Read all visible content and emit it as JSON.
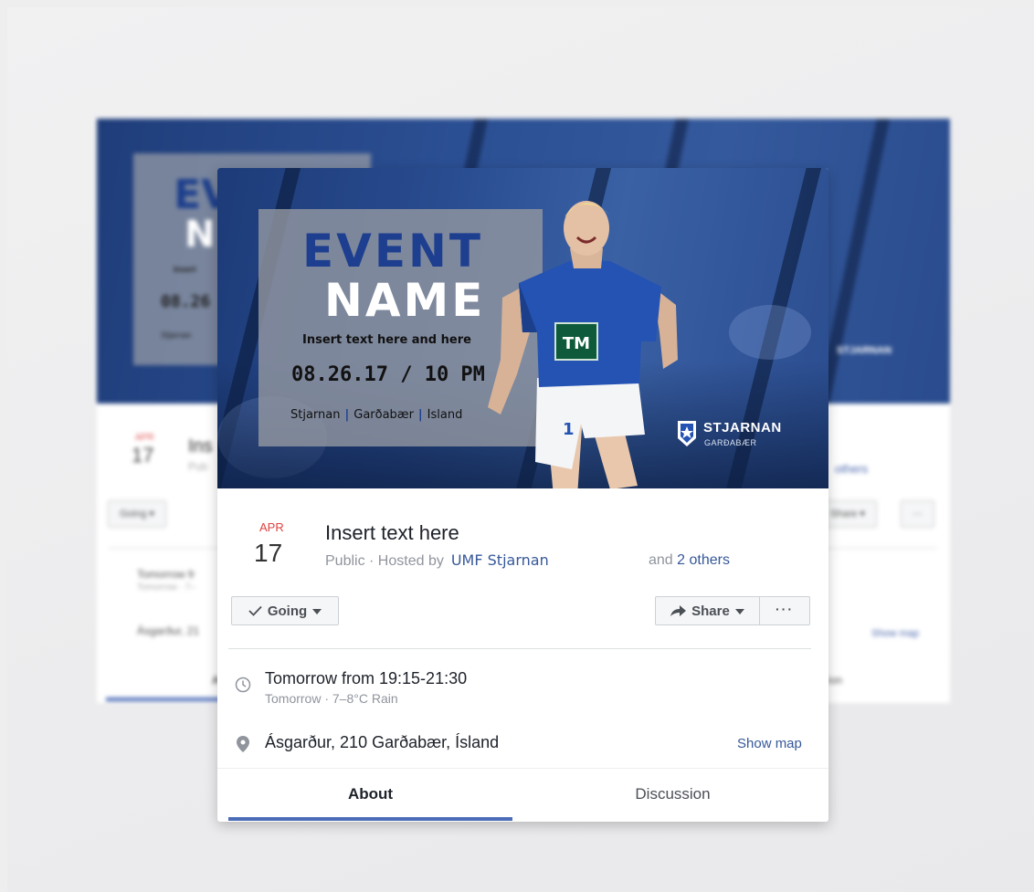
{
  "background_card": {
    "event_fragment": "EV",
    "name_fragment": "N",
    "small_text": "Insert",
    "date_fragment": "08.26",
    "location_fragment": "Stjarnan",
    "month": "APR",
    "day": "17",
    "title_fragment": "Ins",
    "sub_fragment": "Pub",
    "others": "others",
    "going": "Going",
    "share": "Share",
    "time_fragment": "Tomorrow fr",
    "time_sub_fragment": "Tomorrow · 7–",
    "location_row_fragment": "Ásgarður, 21",
    "show_map": "Show map",
    "tab_fragment_left": "A",
    "tab_fragment_right": "ion",
    "logo_text": "STJARNAN"
  },
  "cover": {
    "headline_1": "EVENT",
    "headline_2": "NAME",
    "subtitle": "Insert text here and here",
    "date_time": "08.26.17 / 10 PM",
    "location_1": "Stjarnan",
    "location_2": "Garðabær",
    "location_3": "Ísland",
    "club_name": "STJARNAN",
    "club_sub": "GARÐABÆR",
    "jersey_text": "TM",
    "colors": {
      "brand_blue": "#1e3f8f",
      "overlay": "#91969f",
      "cover_bg": "#294c90"
    }
  },
  "event": {
    "month": "APR",
    "day": "17",
    "title": "Insert text here",
    "visibility": "Public · Hosted by",
    "host": "UMF Stjarnan",
    "others_prefix": "and",
    "others_link": "2 others"
  },
  "actions": {
    "going_label": "Going",
    "share_label": "Share",
    "more_label": "···"
  },
  "details": {
    "time_main": "Tomorrow from 19:15-21:30",
    "time_sub": "Tomorrow · 7–8°C Rain",
    "location": "Ásgarður, 210 Garðabær, Ísland",
    "show_map": "Show map"
  },
  "tabs": [
    {
      "label": "About",
      "active": true
    },
    {
      "label": "Discussion",
      "active": false
    }
  ]
}
